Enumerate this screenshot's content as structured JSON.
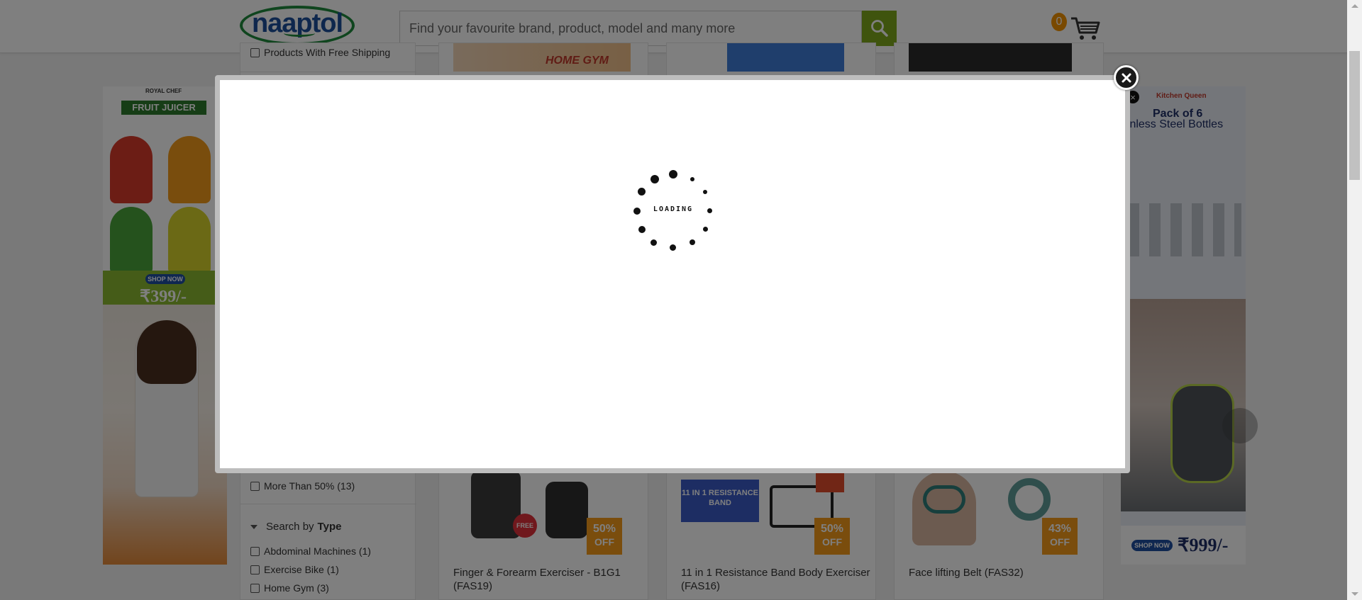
{
  "header": {
    "logo_text": "naaptol",
    "search_placeholder": "Find your favourite brand, product, model and many more",
    "cart_count": "0"
  },
  "left_ad": {
    "brand": "ROYAL CHEF",
    "title": "FRUIT JUICER",
    "shop_now": "SHOP NOW",
    "price": "₹399/-"
  },
  "right_ad": {
    "brand": "Kitchen Queen",
    "title_line1": "Pack of 6",
    "title_line2": "ainless Steel Bottles",
    "shop_now": "SHOP NOW",
    "price": "₹999/-"
  },
  "filters": {
    "free_shipping": "Products With Free Shipping",
    "discount_option": "More Than 50% (13)",
    "type_heading_prefix": "Search by",
    "type_heading_bold": "Type",
    "type_options": [
      "Abdominal Machines (1)",
      "Exercise Bike (1)",
      "Home Gym (3)"
    ]
  },
  "products": [
    {
      "top_label": "HOME GYM",
      "discount_value": "50%",
      "discount_label": "OFF",
      "name": "Finger & Forearm Exerciser - B1G1 (FAS19)",
      "free_tag": "FREE"
    },
    {
      "top_label": "",
      "discount_value": "50%",
      "discount_label": "OFF",
      "name": "11 in 1 Resistance Band Body Exerciser (FAS16)",
      "img_text": "11 IN 1 RESISTANCE BAND"
    },
    {
      "top_label": "",
      "discount_value": "43%",
      "discount_label": "OFF",
      "name": "Face lifting Belt (FAS32)"
    }
  ],
  "modal": {
    "loading_text": "LOADING"
  },
  "colors": {
    "search_button": "#7fa81c",
    "cart_badge": "#f29300",
    "discount_badge": "#f49a1a",
    "overlay": "rgba(0,0,0,0.5)"
  }
}
